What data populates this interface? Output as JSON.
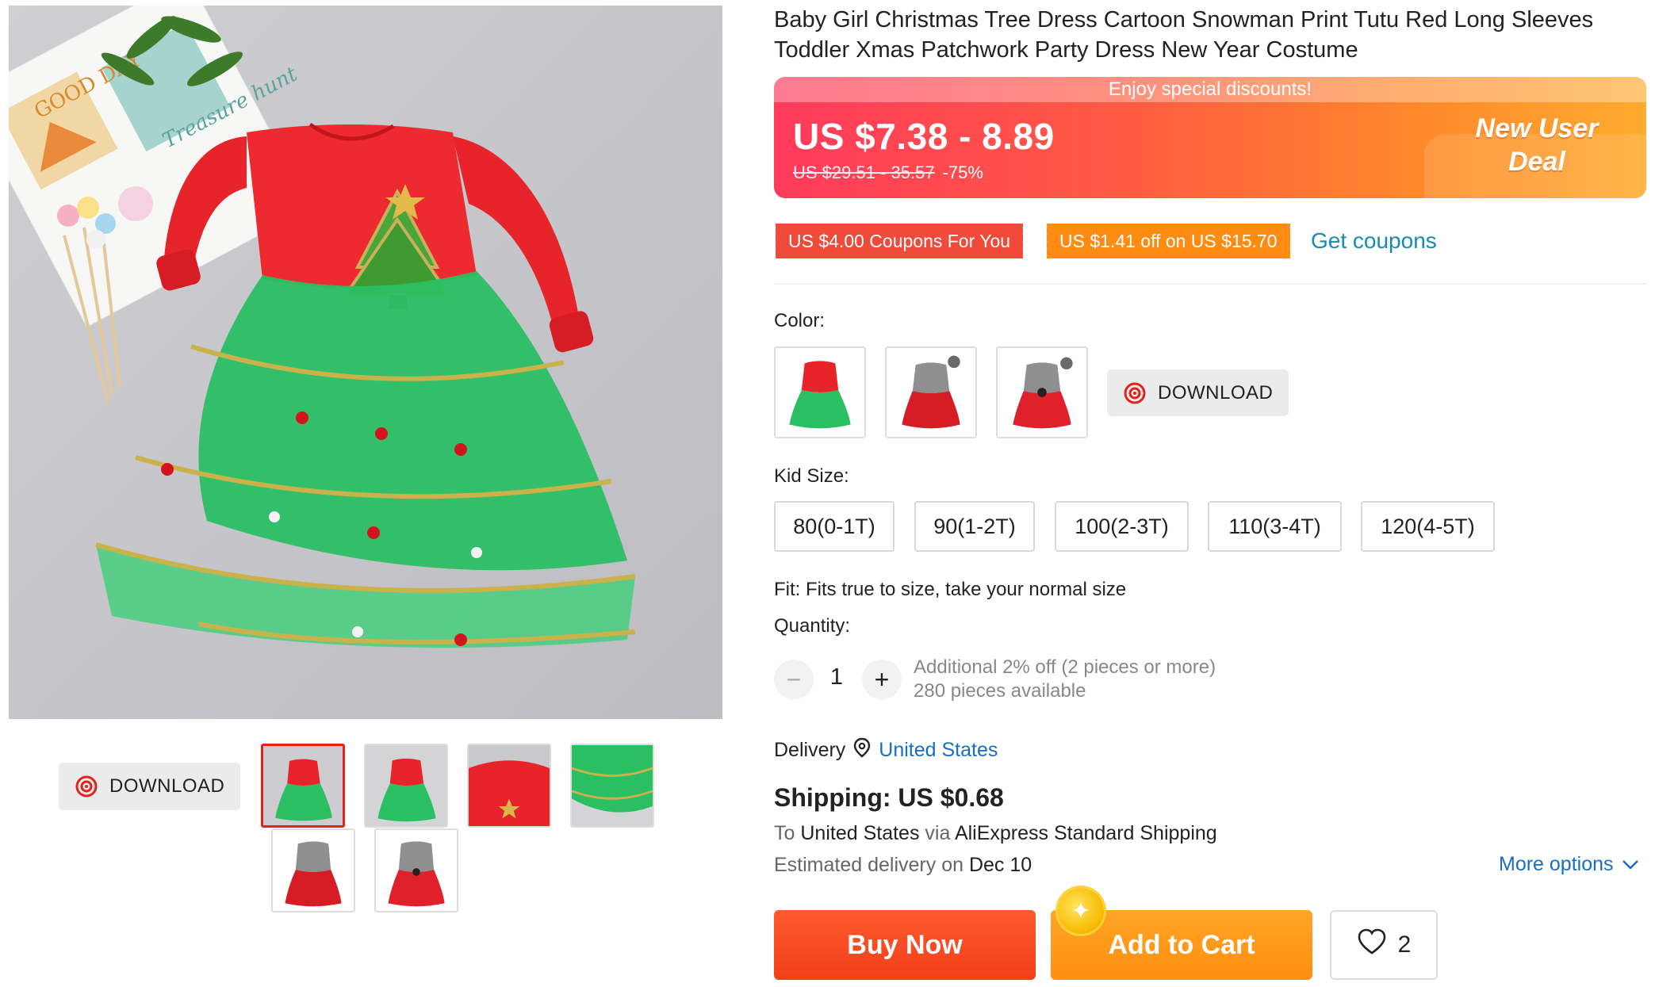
{
  "product": {
    "title": "Baby Girl Christmas Tree Dress Cartoon Snowman Print Tutu Red Long Sleeves Toddler Xmas Patchwork Party Dress New Year Costume"
  },
  "gallery": {
    "download_label": "DOWNLOAD",
    "main_image_alt": "Treasure hunt",
    "card_text_1": "GOOD DAY",
    "card_text_2": "Treasure hunt"
  },
  "price": {
    "promo_text": "Enjoy special discounts!",
    "current": "US $7.38 - 8.89",
    "original": "US $29.51 - 35.57",
    "discount": "-75%",
    "deal_line1": "New User",
    "deal_line2": "Deal"
  },
  "coupons": {
    "coupon1": "US $4.00 Coupons For You",
    "coupon2": "US $1.41 off on US $15.70",
    "get_label": "Get coupons"
  },
  "color": {
    "label": "Color:",
    "download_label": "DOWNLOAD"
  },
  "size": {
    "label": "Kid Size:",
    "options": [
      "80(0-1T)",
      "90(1-2T)",
      "100(2-3T)",
      "110(3-4T)",
      "120(4-5T)"
    ],
    "fit_text": "Fit: Fits true to size, take your normal size"
  },
  "quantity": {
    "label": "Quantity:",
    "minus": "−",
    "plus": "+",
    "value": "1",
    "additional": "Additional 2% off (2 pieces or more)",
    "available": "280 pieces available"
  },
  "delivery": {
    "label": "Delivery",
    "location": "United States"
  },
  "shipping": {
    "price_label": "Shipping: US $0.68",
    "to_prefix": "To ",
    "to_country": "United States",
    "via_prefix": " via ",
    "via_method": "AliExpress Standard Shipping",
    "est_prefix": "Estimated delivery on ",
    "est_date": "Dec 10",
    "more_options": "More options"
  },
  "actions": {
    "buy_now": "Buy Now",
    "add_to_cart": "Add to Cart",
    "wishlist_count": "2"
  },
  "colors": {
    "accent_red": "#e2231a",
    "link_blue": "#1a6ec0",
    "coupon_red": "#f04a3a",
    "coupon_orange": "#ff8c12"
  }
}
